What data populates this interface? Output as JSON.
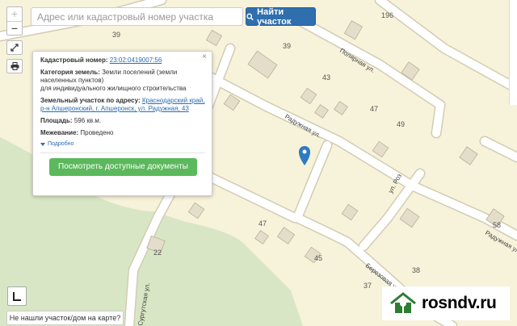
{
  "search": {
    "placeholder": "Адрес или кадастровый номер участка",
    "button_label": "Найти участок",
    "button_icon": "search-icon"
  },
  "zoom": {
    "in_label": "+",
    "out_label": "−"
  },
  "map": {
    "colors": {
      "land": "#f7f2da",
      "forest": "#d8e6c5",
      "road": "#ffffff",
      "road_edge": "#cfc9b0",
      "building": "#e4ddc9",
      "building_edge": "#b9b09a",
      "marker": "#2d7cc1"
    },
    "house_numbers": [
      "39",
      "39",
      "196",
      "43",
      "47",
      "49",
      "47",
      "45",
      "38",
      "37",
      "58",
      "22"
    ],
    "streets": [
      "Полярная ул.",
      "Радужная ул.",
      "ул. Роз",
      "Радужная ул.",
      "Березовая ул.",
      "Сургутская ул."
    ]
  },
  "popup": {
    "close_label": "×",
    "cadastral_label": "Кадастровый номер:",
    "cadastral_value": "23:02:0419007:56",
    "category_label": "Категория земель:",
    "category_value_1": "Земли поселений (земли",
    "category_value_2": "населенных пунктов)",
    "category_value_3": "для индивидуального жилищного строительства",
    "address_label": "Земельный участок по адресу:",
    "address_value_1": "Краснодарский край,",
    "address_value_2": "р-н Апшеронский, г. Апшеронск, ул. Радужная, 43",
    "area_label": "Площадь:",
    "area_value": "596 кв.м.",
    "survey_label": "Межевание:",
    "survey_value": "Проведено",
    "more_label": "Подробно",
    "docs_button": "Посмотреть доступные документы"
  },
  "not_found_label": "Не нашли участок/дом на карте?",
  "watermark": {
    "text": "rosndv.ru",
    "icon": "house-logo-icon"
  }
}
